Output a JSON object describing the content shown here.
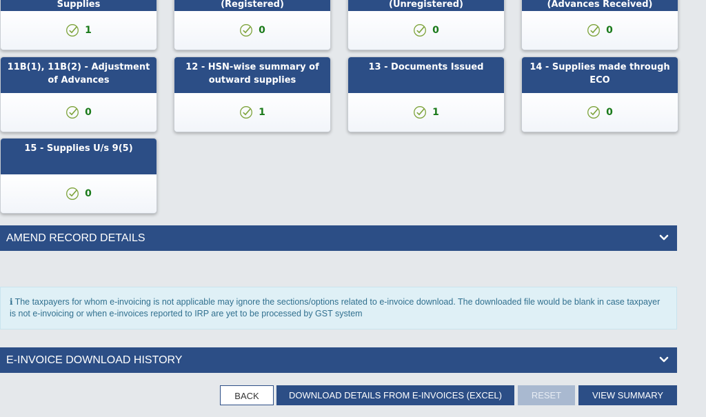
{
  "tiles": [
    {
      "title": "Supplies",
      "count": "1"
    },
    {
      "title": "(Registered)",
      "count": "0"
    },
    {
      "title": "(Unregistered)",
      "count": "0"
    },
    {
      "title": "(Advances Received)",
      "count": "0"
    },
    {
      "title": "11B(1), 11B(2) - Adjustment of Advances",
      "count": "0"
    },
    {
      "title": "12 - HSN-wise summary of outward supplies",
      "count": "1"
    },
    {
      "title": "13 - Documents Issued",
      "count": "1"
    },
    {
      "title": "14 - Supplies made through ECO",
      "count": "0"
    },
    {
      "title": "15 - Supplies U/s 9(5)",
      "count": "0"
    }
  ],
  "sections": {
    "amend": "AMEND RECORD DETAILS",
    "history": "E-INVOICE DOWNLOAD HISTORY"
  },
  "info": {
    "icon": "i",
    "text": "The taxpayers for whom e-invoicing is not applicable may ignore the sections/options related to e-invoice download. The downloaded file would be blank in case taxpayer is not e-invoicing or when e-invoices reported to IRP are yet to be processed by GST system"
  },
  "buttons": {
    "back": "BACK",
    "download": "DOWNLOAD DETAILS FROM E-INVOICES (EXCEL)",
    "reset": "RESET",
    "view_summary": "VIEW SUMMARY"
  },
  "colors": {
    "header_blue": "#2c4e86",
    "count_green": "#1a7a1a",
    "info_bg": "#dff0f6"
  },
  "icons": {
    "status": "check-circle-icon",
    "section_toggle": "chevron-down-icon"
  }
}
